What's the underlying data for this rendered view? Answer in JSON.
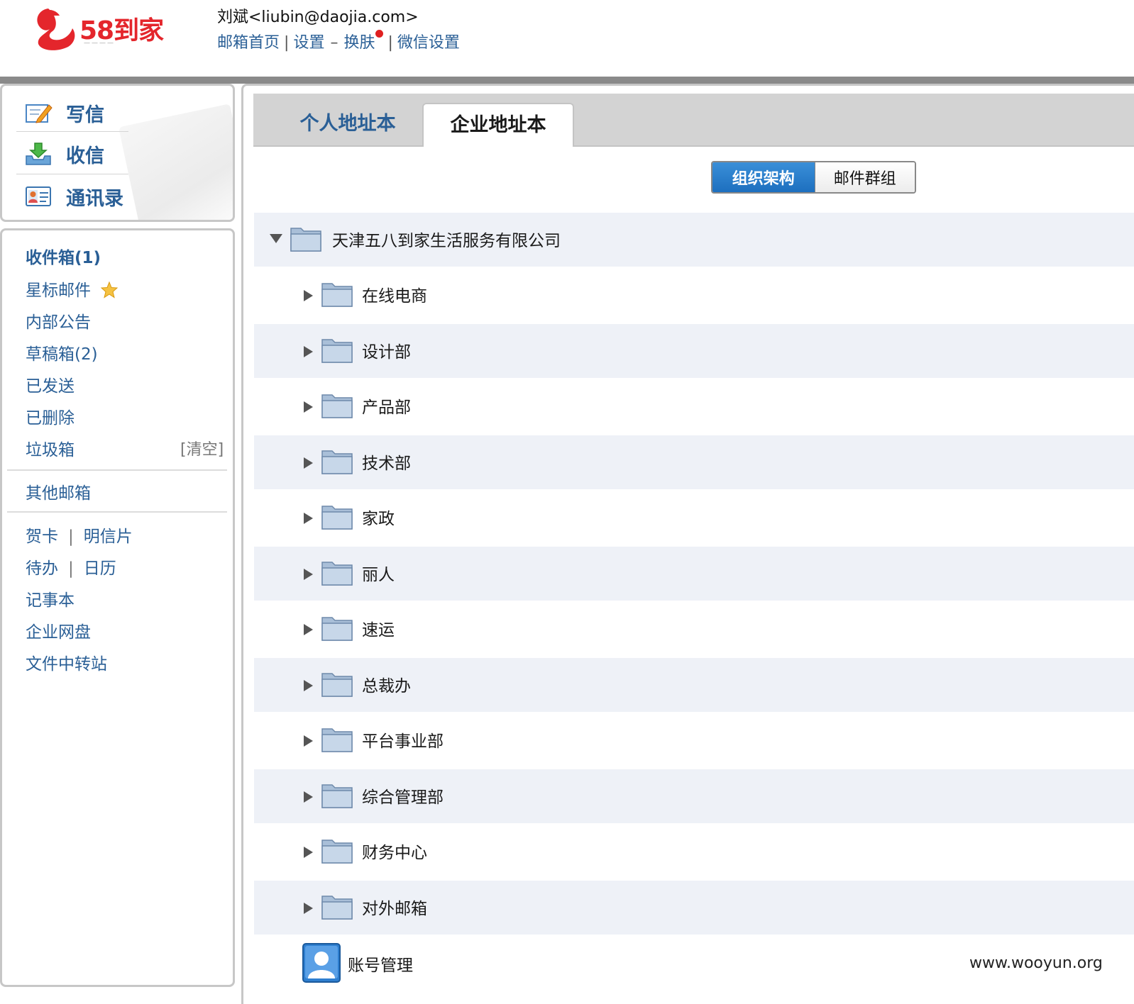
{
  "header": {
    "brand_text": "58到家",
    "brand_tagline": "————",
    "user_line": "刘斌<liubin@daojia.com>",
    "links": {
      "mail_home": "邮箱首页",
      "settings": "设置",
      "dash": "–",
      "skin": "换肤",
      "wechat_settings": "微信设置",
      "separator": "|"
    },
    "accent_color": "#2a5f96",
    "brand_color": "#e4262c"
  },
  "quick_actions": {
    "compose": "写信",
    "receive": "收信",
    "contacts": "通讯录"
  },
  "folders": {
    "inbox": "收件箱(1)",
    "starred": "星标邮件",
    "announcements": "内部公告",
    "drafts": "草稿箱(2)",
    "sent": "已发送",
    "deleted": "已删除",
    "spam": "垃圾箱",
    "spam_clear": "[清空]",
    "other_mailboxes": "其他邮箱"
  },
  "tools": {
    "greeting_card": "贺卡",
    "postcard": "明信片",
    "todo": "待办",
    "calendar": "日历",
    "notebook": "记事本",
    "netdisk": "企业网盘",
    "file_transfer": "文件中转站",
    "separator": "|"
  },
  "tabs": {
    "personal": "个人地址本",
    "enterprise": "企业地址本"
  },
  "view_toggle": {
    "org_structure": "组织架构",
    "mail_groups": "邮件群组",
    "selected": "组织架构"
  },
  "tree": {
    "root": "天津五八到家生活服务有限公司",
    "children": [
      "在线电商",
      "设计部",
      "产品部",
      "技术部",
      "家政",
      "丽人",
      "速运",
      "总裁办",
      "平台事业部",
      "综合管理部",
      "财务中心",
      "对外邮箱"
    ],
    "account_management": "账号管理"
  },
  "watermark": "www.wooyun.org"
}
